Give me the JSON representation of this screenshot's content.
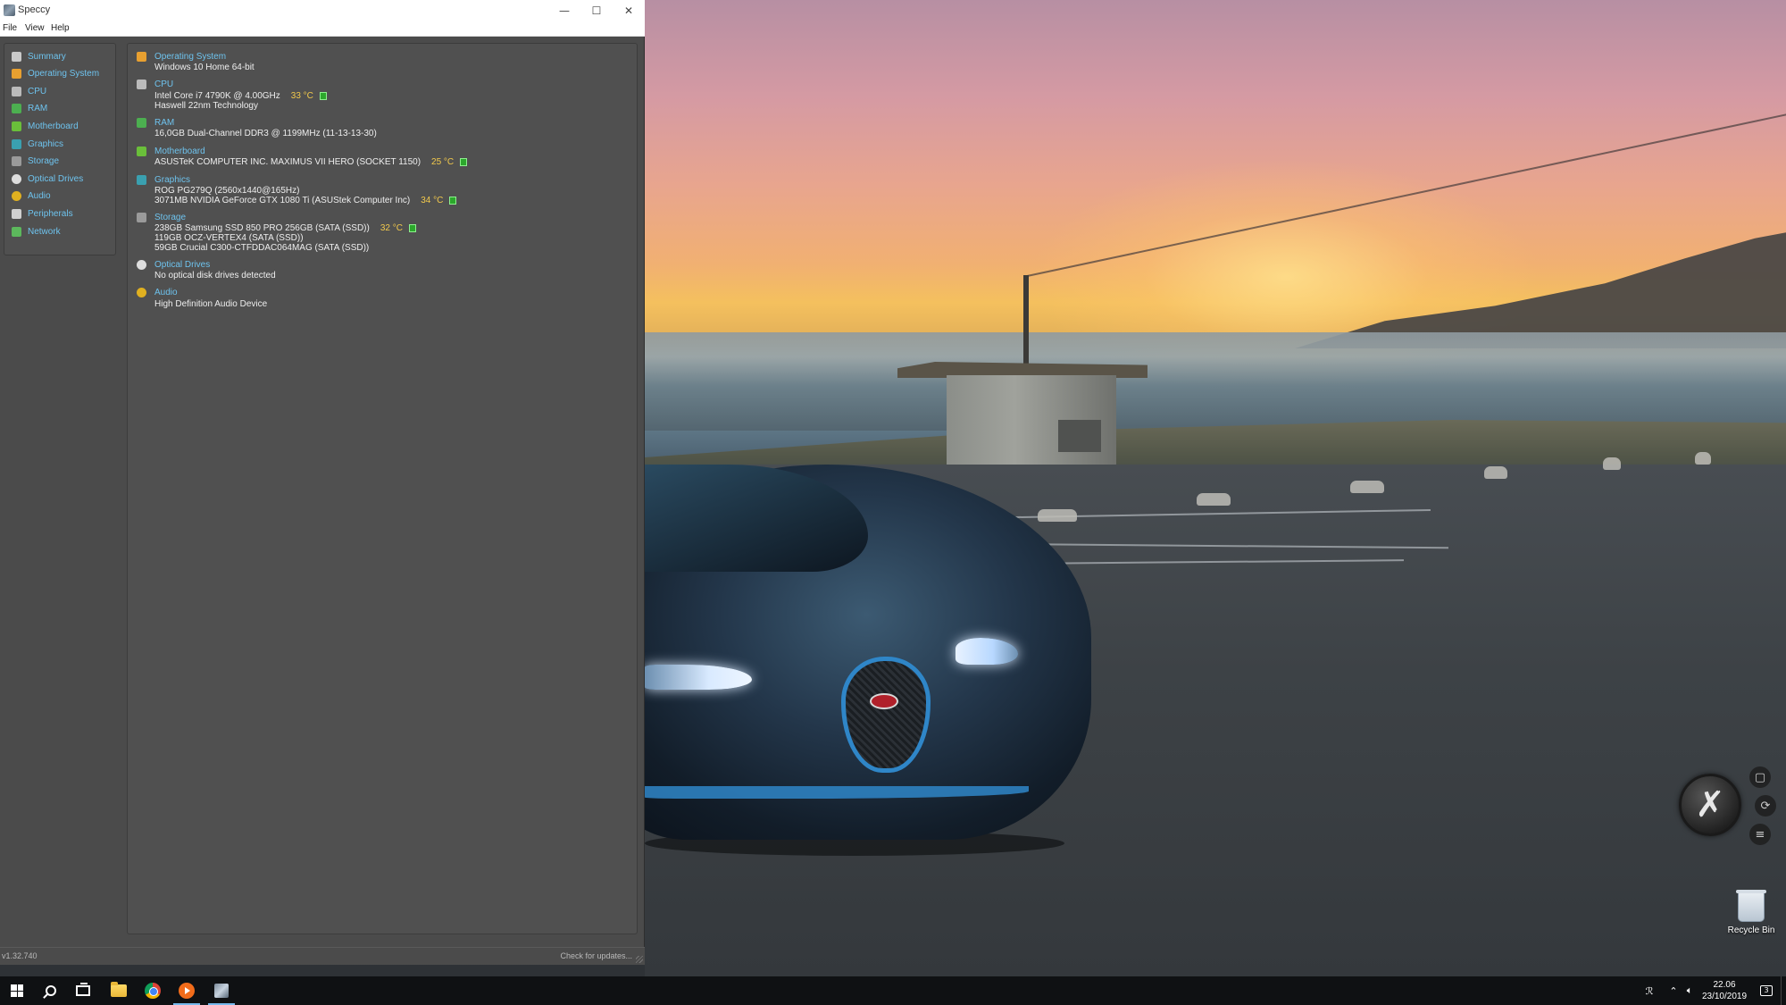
{
  "window": {
    "title": "Speccy",
    "menu": [
      "File",
      "View",
      "Help"
    ],
    "controls": {
      "minimize": "—",
      "maximize": "☐",
      "close": "✕"
    }
  },
  "sidebar": {
    "items": [
      {
        "label": "Summary",
        "icon": "summary-icon",
        "color": "#c9c9c9"
      },
      {
        "label": "Operating System",
        "icon": "windows-logo-icon",
        "color": "#e8a030"
      },
      {
        "label": "CPU",
        "icon": "cpu-icon",
        "color": "#bbbbbb"
      },
      {
        "label": "RAM",
        "icon": "ram-icon",
        "color": "#4caf50"
      },
      {
        "label": "Motherboard",
        "icon": "motherboard-icon",
        "color": "#6abf3a"
      },
      {
        "label": "Graphics",
        "icon": "graphics-icon",
        "color": "#3aa0b0"
      },
      {
        "label": "Storage",
        "icon": "storage-icon",
        "color": "#9a9a9a"
      },
      {
        "label": "Optical Drives",
        "icon": "optical-drive-icon",
        "color": "#dddddd"
      },
      {
        "label": "Audio",
        "icon": "audio-icon",
        "color": "#e0b020"
      },
      {
        "label": "Peripherals",
        "icon": "peripherals-icon",
        "color": "#d0d0d0"
      },
      {
        "label": "Network",
        "icon": "network-icon",
        "color": "#5cb85c"
      }
    ]
  },
  "summary": {
    "sections": [
      {
        "title": "Operating System",
        "icon": "windows-logo-icon",
        "color": "#e8a030",
        "lines": [
          {
            "text": "Windows 10 Home 64-bit",
            "temp": ""
          }
        ]
      },
      {
        "title": "CPU",
        "icon": "cpu-icon",
        "color": "#bbbbbb",
        "lines": [
          {
            "text": "Intel Core i7 4790K @ 4.00GHz",
            "temp": "33 °C"
          },
          {
            "text": "Haswell 22nm Technology",
            "temp": ""
          }
        ]
      },
      {
        "title": "RAM",
        "icon": "ram-icon",
        "color": "#4caf50",
        "lines": [
          {
            "text": "16,0GB Dual-Channel DDR3 @ 1199MHz (11-13-13-30)",
            "temp": ""
          }
        ]
      },
      {
        "title": "Motherboard",
        "icon": "motherboard-icon",
        "color": "#6abf3a",
        "lines": [
          {
            "text": "ASUSTeK COMPUTER INC. MAXIMUS VII HERO (SOCKET 1150)",
            "temp": "25 °C"
          }
        ]
      },
      {
        "title": "Graphics",
        "icon": "graphics-icon",
        "color": "#3aa0b0",
        "lines": [
          {
            "text": "ROG PG279Q (2560x1440@165Hz)",
            "temp": ""
          },
          {
            "text": "3071MB NVIDIA GeForce GTX 1080 Ti (ASUStek Computer Inc)",
            "temp": "34 °C"
          }
        ]
      },
      {
        "title": "Storage",
        "icon": "storage-icon",
        "color": "#9a9a9a",
        "lines": [
          {
            "text": "238GB Samsung SSD 850 PRO 256GB (SATA (SSD))",
            "temp": "32 °C"
          },
          {
            "text": "119GB OCZ-VERTEX4 (SATA (SSD))",
            "temp": ""
          },
          {
            "text": "59GB Crucial C300-CTFDDAC064MAG (SATA (SSD))",
            "temp": ""
          }
        ]
      },
      {
        "title": "Optical Drives",
        "icon": "optical-drive-icon",
        "color": "#dddddd",
        "lines": [
          {
            "text": "No optical disk drives detected",
            "temp": ""
          }
        ]
      },
      {
        "title": "Audio",
        "icon": "audio-icon",
        "color": "#e0b020",
        "lines": [
          {
            "text": "High Definition Audio Device",
            "temp": ""
          }
        ]
      }
    ]
  },
  "status": {
    "version": "v1.32.740",
    "update_link": "Check for updates..."
  },
  "desktop": {
    "recycle_bin_label": "Recycle Bin"
  },
  "taskbar": {
    "clock_time": "22.06",
    "clock_date": "23/10/2019",
    "apps": [
      "start-icon",
      "search-icon",
      "task-view-icon",
      "file-explorer-icon",
      "chrome-icon",
      "media-player-icon",
      "speccy-icon"
    ],
    "tray": [
      "people-icon",
      "chevron-up-icon",
      "volume-icon",
      "notification-icon"
    ],
    "notification_count": "3"
  },
  "colors": {
    "link_blue": "#6ec3ee",
    "temp_yellow": "#f2c94c",
    "temp_ok_green": "#2ca82c"
  }
}
